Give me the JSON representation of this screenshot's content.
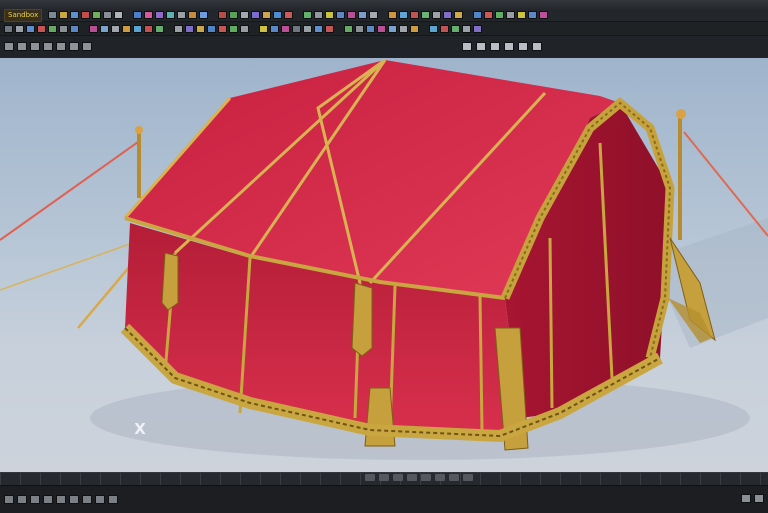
{
  "app": {
    "menu_label": "Sandbox"
  },
  "toolbar_row1_colors": [
    "#7b8a99",
    "#c9a83e",
    "#5d8fd1",
    "#c44c4c",
    "#6fb05b",
    "#8a8f96",
    "#b0b5bb",
    "#4e7ec9",
    "#d65a9b",
    "#8e6cc7",
    "#5ab3b0",
    "#9aa0a6",
    "#c98b3a",
    "#6d9be0",
    "#b94b4b",
    "#58a25a",
    "#a3a8ae",
    "#7d6bd1",
    "#d1a64a",
    "#4c8ed1",
    "#cc5a5a",
    "#62b06a",
    "#9297a0",
    "#c9c23f",
    "#5e86c9",
    "#b85096",
    "#7a9fcf",
    "#a6aab0",
    "#d0963c",
    "#5fa6d6",
    "#c35353",
    "#6bb276",
    "#9ea3a9",
    "#806dc7",
    "#cfaa47",
    "#4f86cc",
    "#cd5656",
    "#5fae63",
    "#999ea5",
    "#cfc33e",
    "#5a88c8",
    "#be4f9a"
  ],
  "toolbar_row2_colors": [
    "#6e7782",
    "#9aa0a8",
    "#5e8ed0",
    "#c55454",
    "#65aa62",
    "#8b9097",
    "#5b87c6",
    "#b84e95",
    "#7aa3cf",
    "#a1a6ad",
    "#d09a3e",
    "#5aa4d2",
    "#c45151",
    "#64ad6e",
    "#9ba0a7",
    "#7f6ec6",
    "#cca74a",
    "#4e85ca",
    "#cb5555",
    "#5dac61",
    "#979ca3",
    "#cdc13f",
    "#5987c7",
    "#bc4e98",
    "#6d7681",
    "#98a0a7",
    "#5f8fcf",
    "#c35656",
    "#66ab63",
    "#8c9198",
    "#5c88c5",
    "#b94f94",
    "#79a2ce",
    "#a0a5ac",
    "#cf9b3f",
    "#5ba5d1",
    "#c55252",
    "#65ae6f",
    "#9ca1a8",
    "#806fc5"
  ],
  "shelf_left_icons": [
    "cube-icon",
    "camera-icon",
    "key-icon",
    "folder-icon",
    "link-icon",
    "layers-icon",
    "chevron-right-icon"
  ],
  "shelf_right_icons": [
    "snap-icon",
    "grid-icon",
    "mesh-icon",
    "frame-icon",
    "render-icon",
    "settings-icon"
  ],
  "viewport": {
    "background_top": "#9fb4cc",
    "tent_color": "#d42d4c",
    "trim_color": "#c9a640",
    "axis_gizmo_label": "X"
  },
  "timeline": {
    "left_icons": [
      "home-icon",
      "prev-frame-icon",
      "play-icon",
      "next-frame-icon",
      "loop-icon",
      "key-icon",
      "record-icon",
      "settings-icon",
      "chevron-right-icon"
    ],
    "mid_chips": 8,
    "right_icons": [
      "view-icon",
      "expand-icon"
    ]
  }
}
